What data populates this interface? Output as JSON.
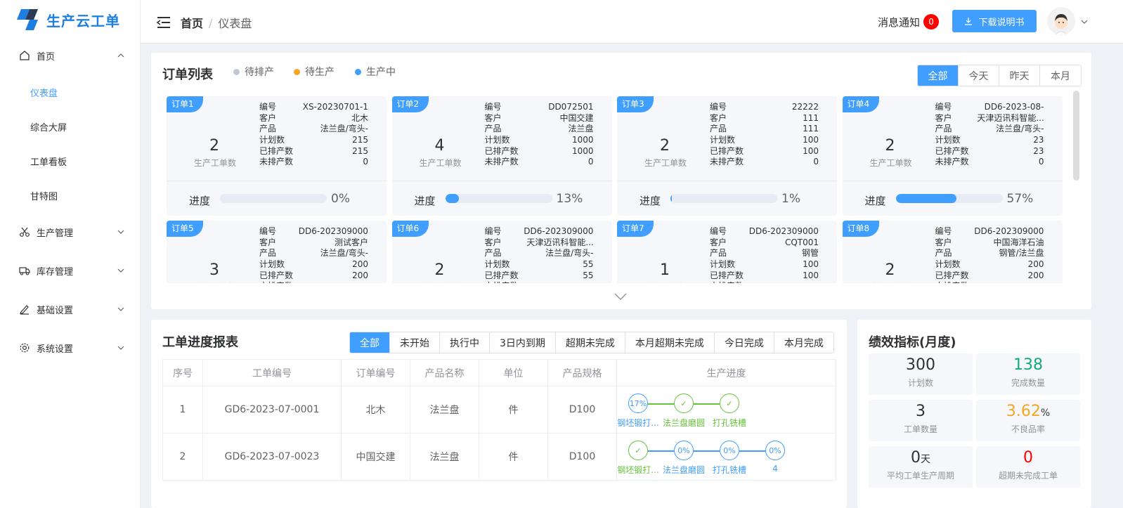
{
  "app": {
    "title": "生产云工单"
  },
  "sidebar": {
    "home": "首页",
    "sub_items": [
      "仪表盘",
      "综合大屏",
      "工单看板",
      "甘特图"
    ],
    "groups": [
      "生产管理",
      "库存管理",
      "基础设置",
      "系统设置"
    ]
  },
  "header": {
    "breadcrumb_home": "首页",
    "breadcrumb_sep": "/",
    "breadcrumb_current": "仪表盘",
    "notice_label": "消息通知",
    "notice_count": "0",
    "download_label": "下载说明书"
  },
  "orders": {
    "title": "订单列表",
    "legend": [
      {
        "label": "待排产",
        "color": "#c0c8d4"
      },
      {
        "label": "待生产",
        "color": "#f5a623"
      },
      {
        "label": "生产中",
        "color": "#409eff"
      }
    ],
    "ranges": [
      "全部",
      "今天",
      "昨天",
      "本月"
    ],
    "count_label": "生产工单数",
    "progress_label": "进度",
    "row_keys": [
      "编号",
      "客户",
      "产品",
      "计划数",
      "已排产数",
      "未排产数"
    ],
    "cards": [
      {
        "tag": "订单1",
        "count": "2",
        "values": [
          "XS-20230701-1",
          "北木",
          "法兰盘/弯头-",
          "215",
          "215",
          "0"
        ],
        "progress": 0,
        "pct": "0%"
      },
      {
        "tag": "订单2",
        "count": "4",
        "values": [
          "DD072501",
          "中国交建",
          "法兰盘",
          "1000",
          "1000",
          "0"
        ],
        "progress": 13,
        "pct": "13%"
      },
      {
        "tag": "订单3",
        "count": "2",
        "values": [
          "22222",
          "111",
          "111",
          "100",
          "100",
          "0"
        ],
        "progress": 1,
        "pct": "1%"
      },
      {
        "tag": "订单4",
        "count": "2",
        "values": [
          "DD6-2023-08-",
          "天津迈讯科智能...",
          "法兰盘/弯头-",
          "23",
          "23",
          "0"
        ],
        "progress": 57,
        "pct": "57%"
      },
      {
        "tag": "订单5",
        "count": "3",
        "values": [
          "DD6-2023090004",
          "测试客户",
          "法兰盘/弯头-",
          "200",
          "200",
          ""
        ],
        "progress": 0,
        "pct": ""
      },
      {
        "tag": "订单6",
        "count": "2",
        "values": [
          "DD6-2023090005",
          "天津迈讯科智能...",
          "法兰盘/弯头-",
          "55",
          "55",
          ""
        ],
        "progress": 0,
        "pct": ""
      },
      {
        "tag": "订单7",
        "count": "1",
        "values": [
          "DD6-2023090008",
          "CQT001",
          "钢管",
          "100",
          "100",
          ""
        ],
        "progress": 0,
        "pct": ""
      },
      {
        "tag": "订单8",
        "count": "2",
        "values": [
          "DD6-2023090009",
          "中国海洋石油",
          "钢管/法兰盘",
          "200",
          "200",
          ""
        ],
        "progress": 0,
        "pct": ""
      }
    ]
  },
  "report": {
    "title": "工单进度报表",
    "filters": [
      "全部",
      "未开始",
      "执行中",
      "3日内到期",
      "超期未完成",
      "本月超期未完成",
      "今日完成",
      "本月完成"
    ],
    "columns": [
      "序号",
      "工单编号",
      "订单编号",
      "产品名称",
      "单位",
      "产品规格",
      "生产进度"
    ],
    "rows": [
      {
        "no": "1",
        "wo": "GD6-2023-07-0001",
        "order": "北木",
        "product": "法兰盘",
        "unit": "件",
        "spec": "D100",
        "steps": [
          {
            "label": "钢坯锻打...",
            "value": "17%",
            "done": false
          },
          {
            "label": "法兰盘磨圆",
            "value": "✓",
            "done": true
          },
          {
            "label": "打孔铣槽",
            "value": "✓",
            "done": true
          }
        ]
      },
      {
        "no": "2",
        "wo": "GD6-2023-07-0023",
        "order": "中国交建",
        "product": "法兰盘",
        "unit": "件",
        "spec": "D100",
        "steps": [
          {
            "label": "钢坯锻打...",
            "value": "✓",
            "done": true
          },
          {
            "label": "法兰盘磨圆",
            "value": "0%",
            "done": false
          },
          {
            "label": "打孔铣槽",
            "value": "0%",
            "done": false
          },
          {
            "label": "4",
            "value": "0%",
            "done": false
          }
        ]
      }
    ]
  },
  "kpi": {
    "title": "绩效指标(月度)",
    "items": [
      {
        "value": "300",
        "unit": "",
        "label": "计划数",
        "color": "#303133"
      },
      {
        "value": "138",
        "unit": "",
        "label": "完成数量",
        "color": "#13a87e"
      },
      {
        "value": "3",
        "unit": "",
        "label": "工单数量",
        "color": "#303133"
      },
      {
        "value": "3.62",
        "unit": "%",
        "label": "不良品率",
        "color": "#f5a623"
      },
      {
        "value": "0",
        "unit": "天",
        "label": "平均工单生产周期",
        "color": "#303133"
      },
      {
        "value": "0",
        "unit": "",
        "label": "超期未完成工单",
        "color": "#f00"
      }
    ]
  }
}
